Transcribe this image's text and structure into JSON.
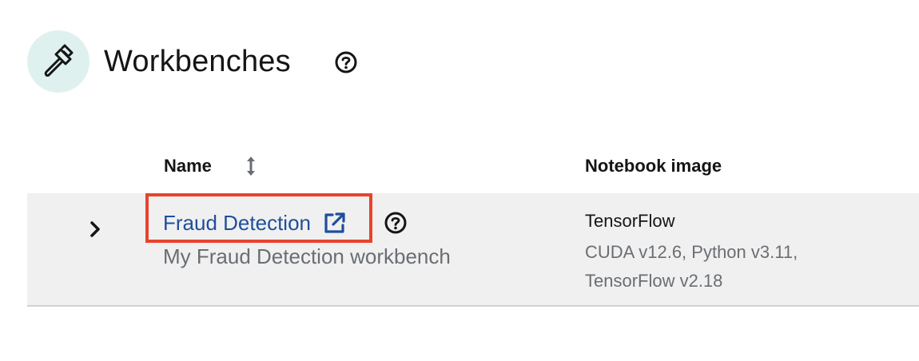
{
  "header": {
    "title": "Workbenches",
    "icon": "wrench-icon",
    "help_icon": "question-circle-icon"
  },
  "table": {
    "columns": {
      "name": "Name",
      "notebook_image": "Notebook image"
    },
    "rows": [
      {
        "name": "Fraud Detection",
        "description": "My Fraud Detection workbench",
        "image_name": "TensorFlow",
        "image_detail": "CUDA v12.6, Python v3.11, TensorFlow v2.18"
      }
    ]
  },
  "colors": {
    "link": "#1f4e9c",
    "highlight_border": "#e8432d",
    "header_icon_bg": "#dff1ef",
    "row_bg": "#f0f0f0"
  }
}
